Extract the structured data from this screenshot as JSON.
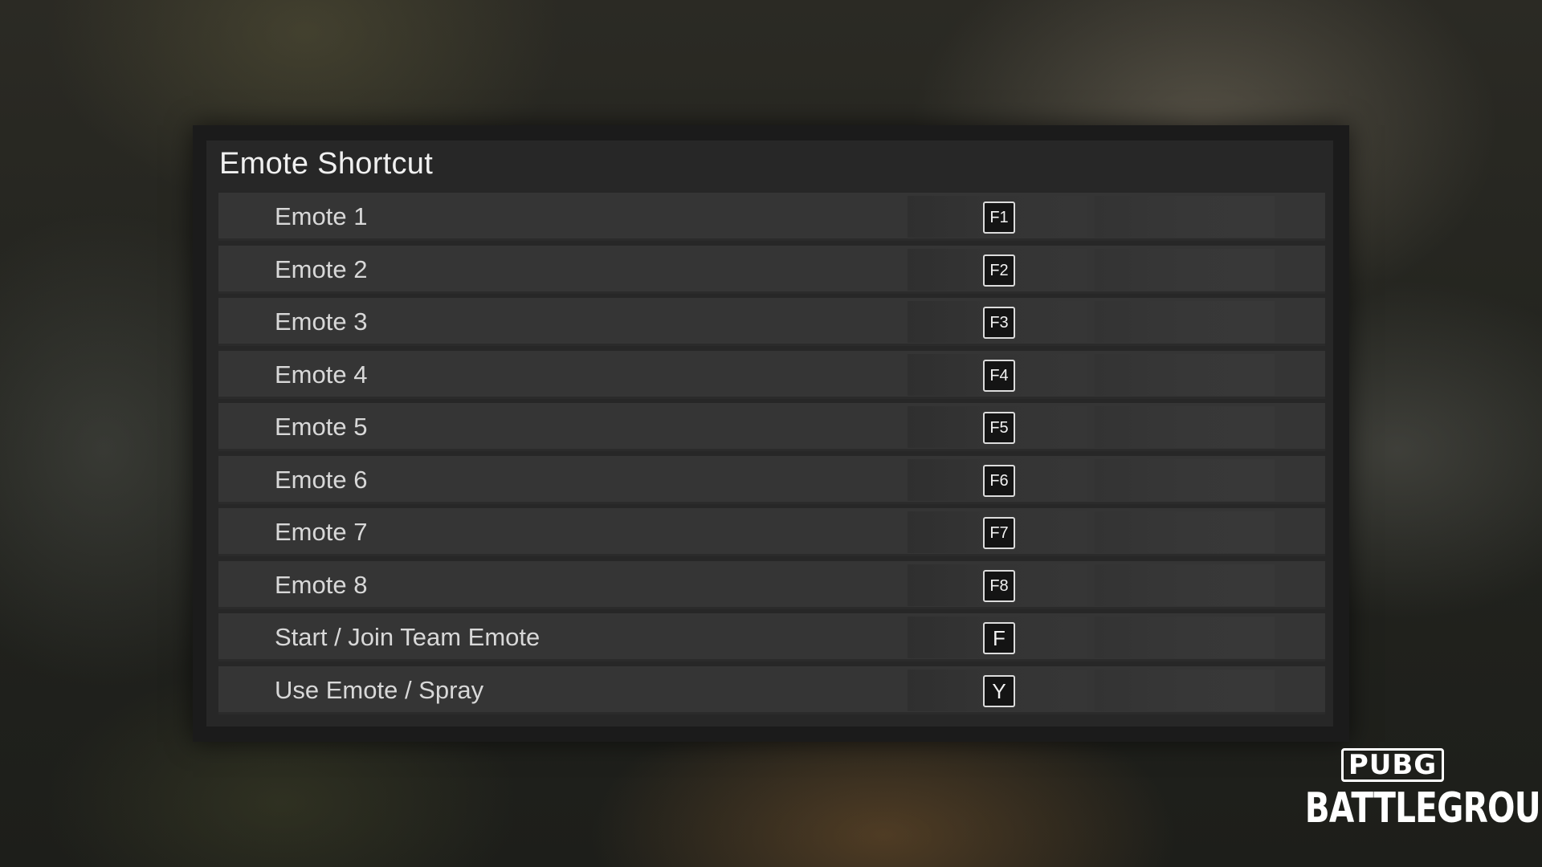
{
  "panel": {
    "title": "Emote Shortcut"
  },
  "rows": [
    {
      "label": "Emote 1",
      "key": "F1"
    },
    {
      "label": "Emote 2",
      "key": "F2"
    },
    {
      "label": "Emote 3",
      "key": "F3"
    },
    {
      "label": "Emote 4",
      "key": "F4"
    },
    {
      "label": "Emote 5",
      "key": "F5"
    },
    {
      "label": "Emote 6",
      "key": "F6"
    },
    {
      "label": "Emote 7",
      "key": "F7"
    },
    {
      "label": "Emote 8",
      "key": "F8"
    },
    {
      "label": "Start / Join Team Emote",
      "key": "F"
    },
    {
      "label": "Use Emote / Spray",
      "key": "Y"
    }
  ],
  "logo": {
    "line1": "PUBG",
    "line2": "BATTLEGROUNDS"
  }
}
